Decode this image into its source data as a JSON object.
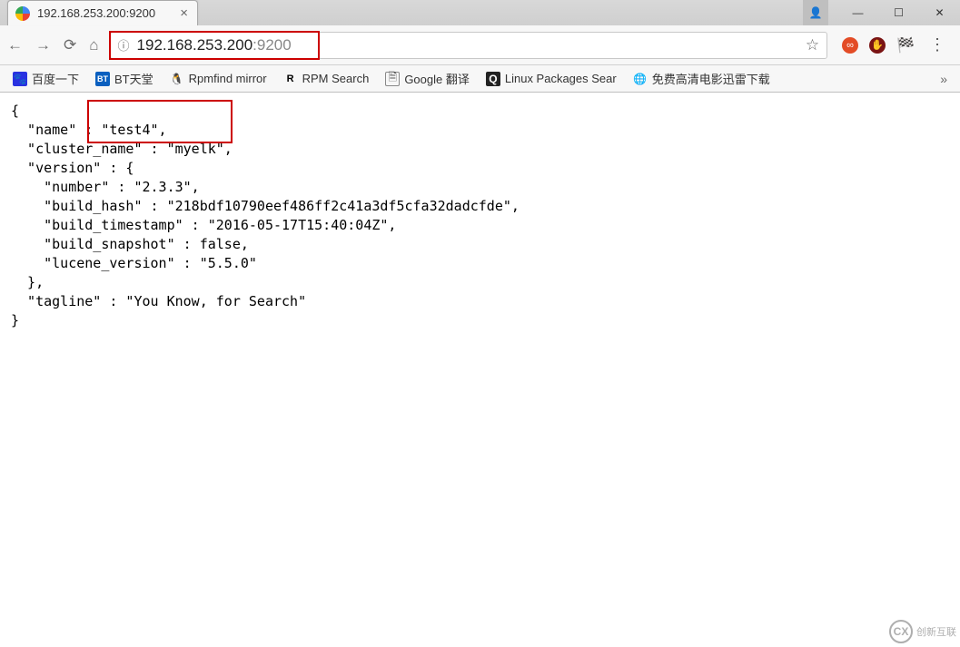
{
  "window": {
    "minimize_label": "—",
    "maximize_label": "☐",
    "close_label": "✕"
  },
  "tab": {
    "title": "192.168.253.200:9200",
    "close_glyph": "×"
  },
  "toolbar": {
    "url_host": "192.168.253.200",
    "url_port": ":9200",
    "url_full": "192.168.253.200:9200"
  },
  "bookmarks": [
    {
      "label": "百度一下",
      "icon": "baidu"
    },
    {
      "label": "BT天堂",
      "icon": "bt"
    },
    {
      "label": "Rpmfind mirror",
      "icon": "tux"
    },
    {
      "label": "RPM Search",
      "icon": "rpm"
    },
    {
      "label": "Google 翻译",
      "icon": "doc"
    },
    {
      "label": "Linux Packages Sear",
      "icon": "q"
    },
    {
      "label": "免费高清电影迅雷下载",
      "icon": "globe"
    }
  ],
  "json_body": {
    "line0": "{",
    "line1": "  \"name\" : \"test4\",",
    "line2": "  \"cluster_name\" : \"myelk\",",
    "line3": "  \"version\" : {",
    "line4": "    \"number\" : \"2.3.3\",",
    "line5": "    \"build_hash\" : \"218bdf10790eef486ff2c41a3df5cfa32dadcfde\",",
    "line6": "    \"build_timestamp\" : \"2016-05-17T15:40:04Z\",",
    "line7": "    \"build_snapshot\" : false,",
    "line8": "    \"lucene_version\" : \"5.5.0\"",
    "line9": "  },",
    "line10": "  \"tagline\" : \"You Know, for Search\"",
    "line11": "}"
  },
  "watermark": {
    "text": "创新互联"
  }
}
